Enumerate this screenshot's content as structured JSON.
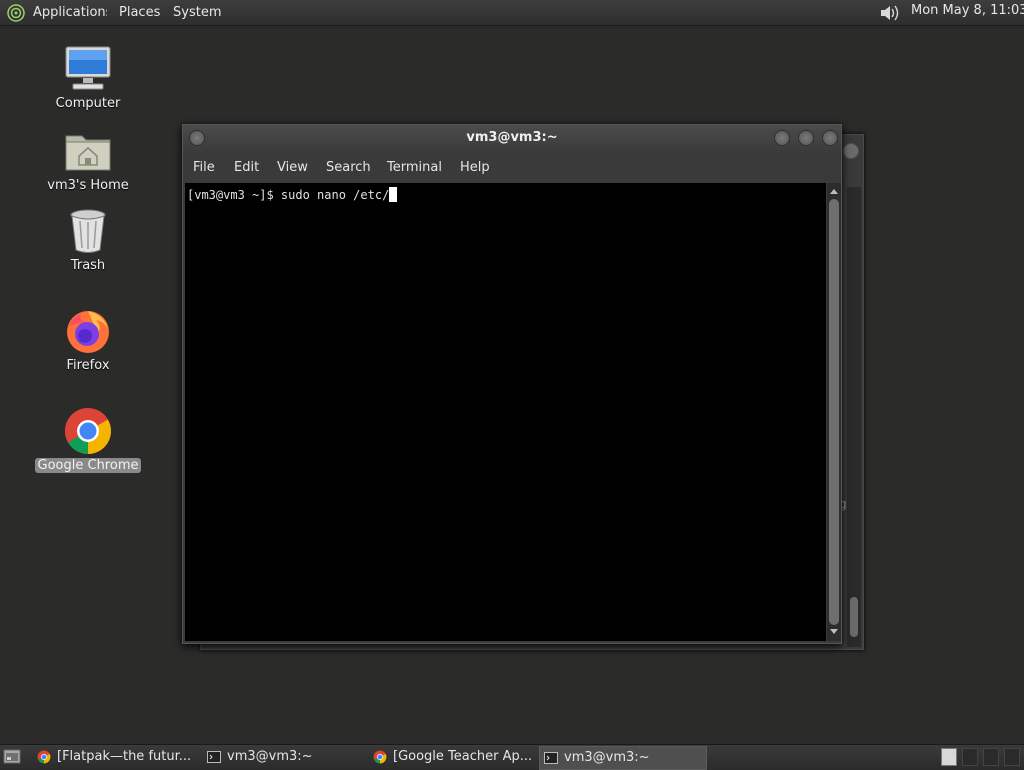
{
  "top_panel": {
    "menus": {
      "applications": "Applications",
      "places": "Places",
      "system": "System"
    },
    "clock": "Mon May  8, 11:03"
  },
  "desktop_icons": [
    {
      "label": "Computer",
      "icon": "computer-icon"
    },
    {
      "label": "vm3's Home",
      "icon": "home-folder-icon"
    },
    {
      "label": "Trash",
      "icon": "trash-icon"
    },
    {
      "label": "Firefox",
      "icon": "firefox-icon"
    },
    {
      "label": "Google Chrome",
      "icon": "chrome-icon",
      "selected": true
    }
  ],
  "terminal": {
    "title": "vm3@vm3:~",
    "menu": [
      "File",
      "Edit",
      "View",
      "Search",
      "Terminal",
      "Help"
    ],
    "prompt": "[vm3@vm3 ~]$ ",
    "command": "sudo nano /etc/"
  },
  "background_window": {
    "partial_text": "g"
  },
  "taskbar": {
    "tasks": [
      {
        "label": "[Flatpak—the futur...",
        "icon": "chrome-icon",
        "active": false
      },
      {
        "label": "vm3@vm3:~",
        "icon": "terminal-icon",
        "active": false
      },
      {
        "label": "[Google Teacher Ap...",
        "icon": "chrome-icon",
        "active": false
      },
      {
        "label": "vm3@vm3:~",
        "icon": "terminal-icon",
        "active": true
      }
    ],
    "workspaces": 4
  },
  "colors": {
    "desktop": "#2b2b2a",
    "terminal_bg": "#000000",
    "panel": "#333333"
  }
}
